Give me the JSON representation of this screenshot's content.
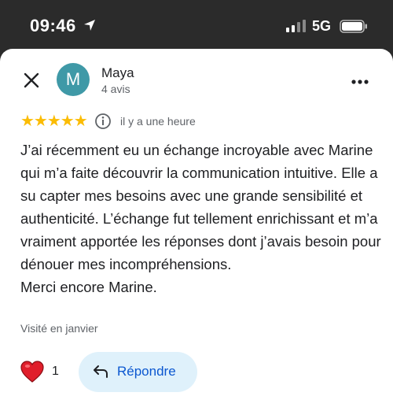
{
  "status_bar": {
    "time": "09:46",
    "network": "5G"
  },
  "review": {
    "author_initial": "M",
    "author_name": "Maya",
    "author_reviews_count": "4 avis",
    "rating": 5,
    "stars_text": "★★★★★",
    "time_ago": "il y a une heure",
    "paragraphs": [
      "J’ai récemment eu un échange incroyable avec Marine qui m’a faite découvrir la communication intuitive. Elle a su capter mes besoins avec une grande sensibilité et authenticité. L’échange fut tellement enrichissant et m’a vraiment apportée les réponses dont j’avais besoin pour dénouer mes incompréhensions.",
      "Merci encore Marine."
    ],
    "visited": "Visité en janvier"
  },
  "actions": {
    "like_count": "1",
    "reply_label": "Répondre"
  },
  "icons": {
    "close": "close-icon",
    "more": "more-icon",
    "info": "info-icon",
    "heart": "heart-icon",
    "reply": "reply-icon",
    "location": "location-arrow-icon",
    "signal": "signal-icon",
    "battery": "battery-icon"
  },
  "colors": {
    "avatar": "#3f99a7",
    "stars": "#fbbc04",
    "reply_bg": "#dff1fb",
    "reply_text": "#0b57d0",
    "heart": "#e01e2b"
  }
}
